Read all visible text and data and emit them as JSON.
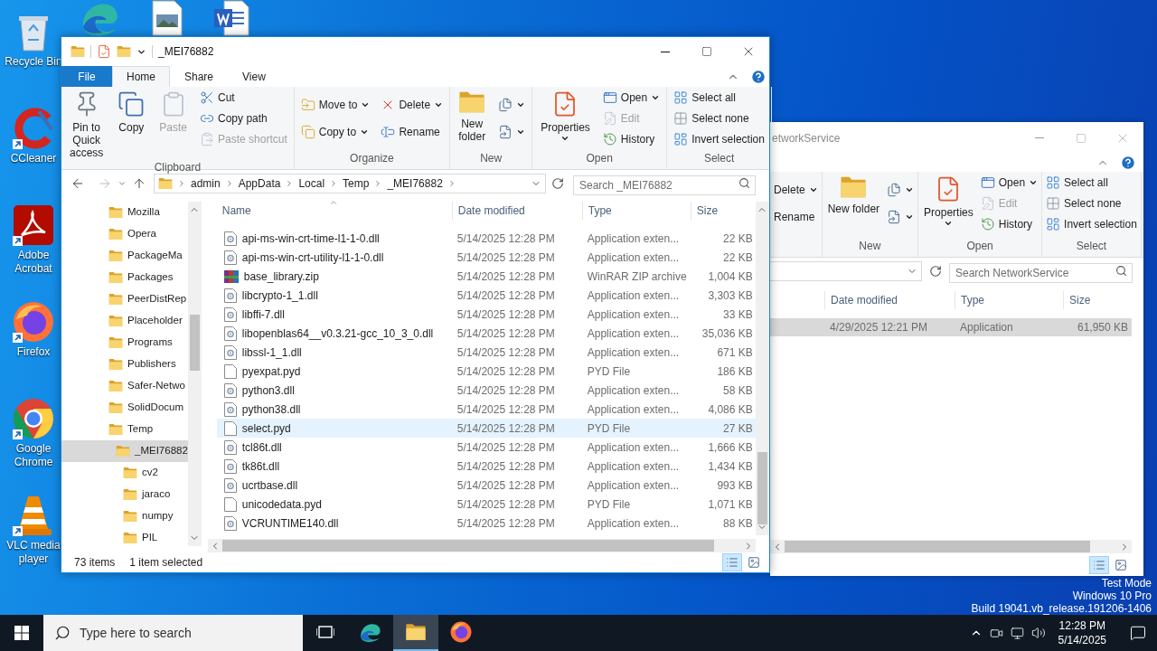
{
  "desktop_top_icons": [
    {
      "kind": "edge"
    },
    {
      "kind": "image"
    },
    {
      "kind": "word"
    }
  ],
  "desktop_icons": [
    {
      "label": "Recycle Bin",
      "kind": "recycle",
      "shortcut": false
    },
    {
      "label": "CCleaner",
      "kind": "ccleaner",
      "shortcut": true
    },
    {
      "label": "Adobe Acrobat",
      "kind": "acrobat",
      "shortcut": true
    },
    {
      "label": "Firefox",
      "kind": "firefox",
      "shortcut": true
    },
    {
      "label": "Google Chrome",
      "kind": "chrome",
      "shortcut": true
    },
    {
      "label": "VLC media player",
      "kind": "vlc",
      "shortcut": true
    }
  ],
  "back_window": {
    "title": "etworkService",
    "groups": [
      {
        "columns": [
          {
            "kind": "small",
            "items": [
              {
                "label": "Delete",
                "dropdown": true,
                "disabled": false
              },
              {
                "label": "Rename",
                "dropdown": false,
                "disabled": false
              }
            ]
          }
        ]
      },
      {
        "label": "New",
        "columns": [
          {
            "kind": "large",
            "items": [
              {
                "label": "New folder",
                "kind": "newfolder",
                "dropdown": false,
                "disabled": false
              }
            ]
          },
          {
            "kind": "small",
            "items": [
              {
                "kind": "newitem",
                "dropdown": true,
                "disabled": false
              },
              {
                "kind": "easyaccess",
                "dropdown": true,
                "disabled": false
              }
            ]
          }
        ]
      },
      {
        "label": "Open",
        "columns": [
          {
            "kind": "large",
            "items": [
              {
                "label": "Properties",
                "kind": "properties",
                "dropdown": true,
                "disabled": false
              }
            ]
          },
          {
            "kind": "small",
            "items": [
              {
                "label": "Open",
                "kind": "open",
                "dropdown": true,
                "disabled": false
              },
              {
                "label": "Edit",
                "kind": "edit",
                "dropdown": false,
                "disabled": true
              },
              {
                "label": "History",
                "kind": "history",
                "dropdown": false,
                "disabled": false
              }
            ]
          }
        ]
      },
      {
        "label": "Select",
        "columns": [
          {
            "kind": "small",
            "items": [
              {
                "label": "Select all",
                "kind": "selectall",
                "dropdown": false,
                "disabled": false
              },
              {
                "label": "Select none",
                "kind": "selectnone",
                "dropdown": false,
                "disabled": false
              },
              {
                "label": "Invert selection",
                "kind": "invert",
                "dropdown": false,
                "disabled": false
              }
            ]
          }
        ]
      }
    ],
    "search": {
      "placeholder": "Search NetworkService"
    },
    "columns": [
      "Date modified",
      "Type",
      "Size"
    ],
    "files": [
      {
        "date": "4/29/2025 12:21 PM",
        "type": "Application",
        "size": "61,950 KB",
        "selected": true
      }
    ],
    "views": [
      {
        "kind": "details",
        "selected": true
      },
      {
        "kind": "tiles",
        "selected": false
      }
    ]
  },
  "front_window": {
    "title": "_MEI76882",
    "tabs": [
      {
        "label": "File",
        "kind": "file",
        "selected": false
      },
      {
        "label": "Home",
        "kind": "tab",
        "selected": true
      },
      {
        "label": "Share",
        "kind": "tab",
        "selected": false
      },
      {
        "label": "View",
        "kind": "tab",
        "selected": false
      }
    ],
    "groups": [
      {
        "label": "Clipboard",
        "columns": [
          {
            "kind": "large",
            "items": [
              {
                "label": "Pin to Quick access",
                "kind": "pin",
                "dropdown": false,
                "disabled": false
              }
            ]
          },
          {
            "kind": "large",
            "items": [
              {
                "label": "Copy",
                "kind": "copy",
                "dropdown": false,
                "disabled": false
              }
            ]
          },
          {
            "kind": "large",
            "items": [
              {
                "label": "Paste",
                "kind": "paste",
                "dropdown": false,
                "disabled": true
              }
            ]
          },
          {
            "kind": "small",
            "items": [
              {
                "label": "Cut",
                "kind": "cut",
                "dropdown": false,
                "disabled": false
              },
              {
                "label": "Copy path",
                "kind": "path",
                "dropdown": false,
                "disabled": false
              },
              {
                "label": "Paste shortcut",
                "kind": "shortcut",
                "dropdown": false,
                "disabled": true
              }
            ]
          }
        ]
      },
      {
        "label": "Organize",
        "columns": [
          {
            "kind": "small",
            "items": [
              {
                "label": "Move to",
                "kind": "moveto",
                "dropdown": true,
                "disabled": false
              },
              {
                "label": "Copy to",
                "kind": "copyto",
                "dropdown": true,
                "disabled": false
              }
            ]
          },
          {
            "kind": "small",
            "items": [
              {
                "label": "Delete",
                "kind": "delete",
                "dropdown": true,
                "disabled": false
              },
              {
                "label": "Rename",
                "kind": "rename",
                "dropdown": false,
                "disabled": false
              }
            ]
          }
        ]
      },
      {
        "label": "New",
        "columns": [
          {
            "kind": "large",
            "items": [
              {
                "label": "New folder",
                "kind": "newfolder",
                "dropdown": false,
                "disabled": false
              }
            ]
          },
          {
            "kind": "small",
            "items": [
              {
                "kind": "newitem",
                "dropdown": true,
                "disabled": false
              },
              {
                "kind": "easyaccess",
                "dropdown": true,
                "disabled": false
              }
            ]
          }
        ]
      },
      {
        "label": "Open",
        "columns": [
          {
            "kind": "large",
            "items": [
              {
                "label": "Properties",
                "kind": "properties",
                "dropdown": true,
                "disabled": false
              }
            ]
          },
          {
            "kind": "small",
            "items": [
              {
                "label": "Open",
                "kind": "open",
                "dropdown": true,
                "disabled": false
              },
              {
                "label": "Edit",
                "kind": "edit",
                "dropdown": false,
                "disabled": true
              },
              {
                "label": "History",
                "kind": "history",
                "dropdown": false,
                "disabled": false
              }
            ]
          }
        ]
      },
      {
        "label": "Select",
        "columns": [
          {
            "kind": "small",
            "items": [
              {
                "label": "Select all",
                "kind": "selectall",
                "dropdown": false,
                "disabled": false
              },
              {
                "label": "Select none",
                "kind": "selectnone",
                "dropdown": false,
                "disabled": false
              },
              {
                "label": "Invert selection",
                "kind": "invert",
                "dropdown": false,
                "disabled": false
              }
            ]
          }
        ]
      }
    ],
    "crumbs": [
      "admin",
      "AppData",
      "Local",
      "Temp",
      "_MEI76882"
    ],
    "search": {
      "placeholder": "Search _MEI76882"
    },
    "nav": [
      {
        "label": "Mozilla",
        "selected": false
      },
      {
        "label": "Opera",
        "selected": false
      },
      {
        "label": "PackageMa",
        "selected": false
      },
      {
        "label": "Packages",
        "selected": false
      },
      {
        "label": "PeerDistRep",
        "selected": false
      },
      {
        "label": "Placeholder",
        "selected": false
      },
      {
        "label": "Programs",
        "selected": false
      },
      {
        "label": "Publishers",
        "selected": false
      },
      {
        "label": "Safer-Netwo",
        "selected": false
      },
      {
        "label": "SolidDocum",
        "selected": false
      },
      {
        "label": "Temp",
        "selected": false,
        "children": [
          {
            "label": "_MEI76882",
            "selected": true,
            "children": [
              {
                "label": "cv2",
                "selected": false
              },
              {
                "label": "jaraco",
                "selected": false
              },
              {
                "label": "numpy",
                "selected": false
              },
              {
                "label": "PIL",
                "selected": false
              }
            ]
          }
        ]
      }
    ],
    "columns": [
      "Name",
      "Date modified",
      "Type",
      "Size"
    ],
    "files": [
      {
        "name": "api-ms-win-crt-time-l1-1-0.dll",
        "date": "5/14/2025 12:28 PM",
        "type": "Application exten...",
        "size": "22 KB",
        "kind": "dll",
        "selected": false
      },
      {
        "name": "api-ms-win-crt-utility-l1-1-0.dll",
        "date": "5/14/2025 12:28 PM",
        "type": "Application exten...",
        "size": "22 KB",
        "kind": "dll",
        "selected": false
      },
      {
        "name": "base_library.zip",
        "date": "5/14/2025 12:28 PM",
        "type": "WinRAR ZIP archive",
        "size": "1,004 KB",
        "kind": "zip",
        "selected": false
      },
      {
        "name": "libcrypto-1_1.dll",
        "date": "5/14/2025 12:28 PM",
        "type": "Application exten...",
        "size": "3,303 KB",
        "kind": "dll",
        "selected": false
      },
      {
        "name": "libffi-7.dll",
        "date": "5/14/2025 12:28 PM",
        "type": "Application exten...",
        "size": "33 KB",
        "kind": "dll",
        "selected": false
      },
      {
        "name": "libopenblas64__v0.3.21-gcc_10_3_0.dll",
        "date": "5/14/2025 12:28 PM",
        "type": "Application exten...",
        "size": "35,036 KB",
        "kind": "dll",
        "selected": false
      },
      {
        "name": "libssl-1_1.dll",
        "date": "5/14/2025 12:28 PM",
        "type": "Application exten...",
        "size": "671 KB",
        "kind": "dll",
        "selected": false
      },
      {
        "name": "pyexpat.pyd",
        "date": "5/14/2025 12:28 PM",
        "type": "PYD File",
        "size": "186 KB",
        "kind": "pyd",
        "selected": false
      },
      {
        "name": "python3.dll",
        "date": "5/14/2025 12:28 PM",
        "type": "Application exten...",
        "size": "58 KB",
        "kind": "dll",
        "selected": false
      },
      {
        "name": "python38.dll",
        "date": "5/14/2025 12:28 PM",
        "type": "Application exten...",
        "size": "4,086 KB",
        "kind": "dll",
        "selected": false
      },
      {
        "name": "select.pyd",
        "date": "5/14/2025 12:28 PM",
        "type": "PYD File",
        "size": "27 KB",
        "kind": "pyd",
        "selected": true
      },
      {
        "name": "tcl86t.dll",
        "date": "5/14/2025 12:28 PM",
        "type": "Application exten...",
        "size": "1,666 KB",
        "kind": "dll",
        "selected": false
      },
      {
        "name": "tk86t.dll",
        "date": "5/14/2025 12:28 PM",
        "type": "Application exten...",
        "size": "1,434 KB",
        "kind": "dll",
        "selected": false
      },
      {
        "name": "ucrtbase.dll",
        "date": "5/14/2025 12:28 PM",
        "type": "Application exten...",
        "size": "993 KB",
        "kind": "dll",
        "selected": false
      },
      {
        "name": "unicodedata.pyd",
        "date": "5/14/2025 12:28 PM",
        "type": "PYD File",
        "size": "1,071 KB",
        "kind": "pyd",
        "selected": false
      },
      {
        "name": "VCRUNTIME140.dll",
        "date": "5/14/2025 12:28 PM",
        "type": "Application exten...",
        "size": "88 KB",
        "kind": "dll",
        "selected": false
      }
    ],
    "status": {
      "count": "73 items",
      "selection": "1 item selected"
    },
    "views": [
      {
        "kind": "details",
        "selected": true
      },
      {
        "kind": "tiles",
        "selected": false
      }
    ]
  },
  "desktop_notice": [
    "Test Mode",
    "Windows 10 Pro",
    "Build 19041.vb_release.191206-1406"
  ],
  "taskbar": {
    "search": {
      "placeholder": "Type here to search"
    },
    "apps": [
      {
        "kind": "taskview",
        "active": false
      },
      {
        "kind": "edge",
        "active": false
      },
      {
        "kind": "explorer",
        "active": true
      },
      {
        "kind": "firefox",
        "active": false
      }
    ],
    "clock": {
      "time": "12:28 PM",
      "date": "5/14/2025"
    }
  }
}
